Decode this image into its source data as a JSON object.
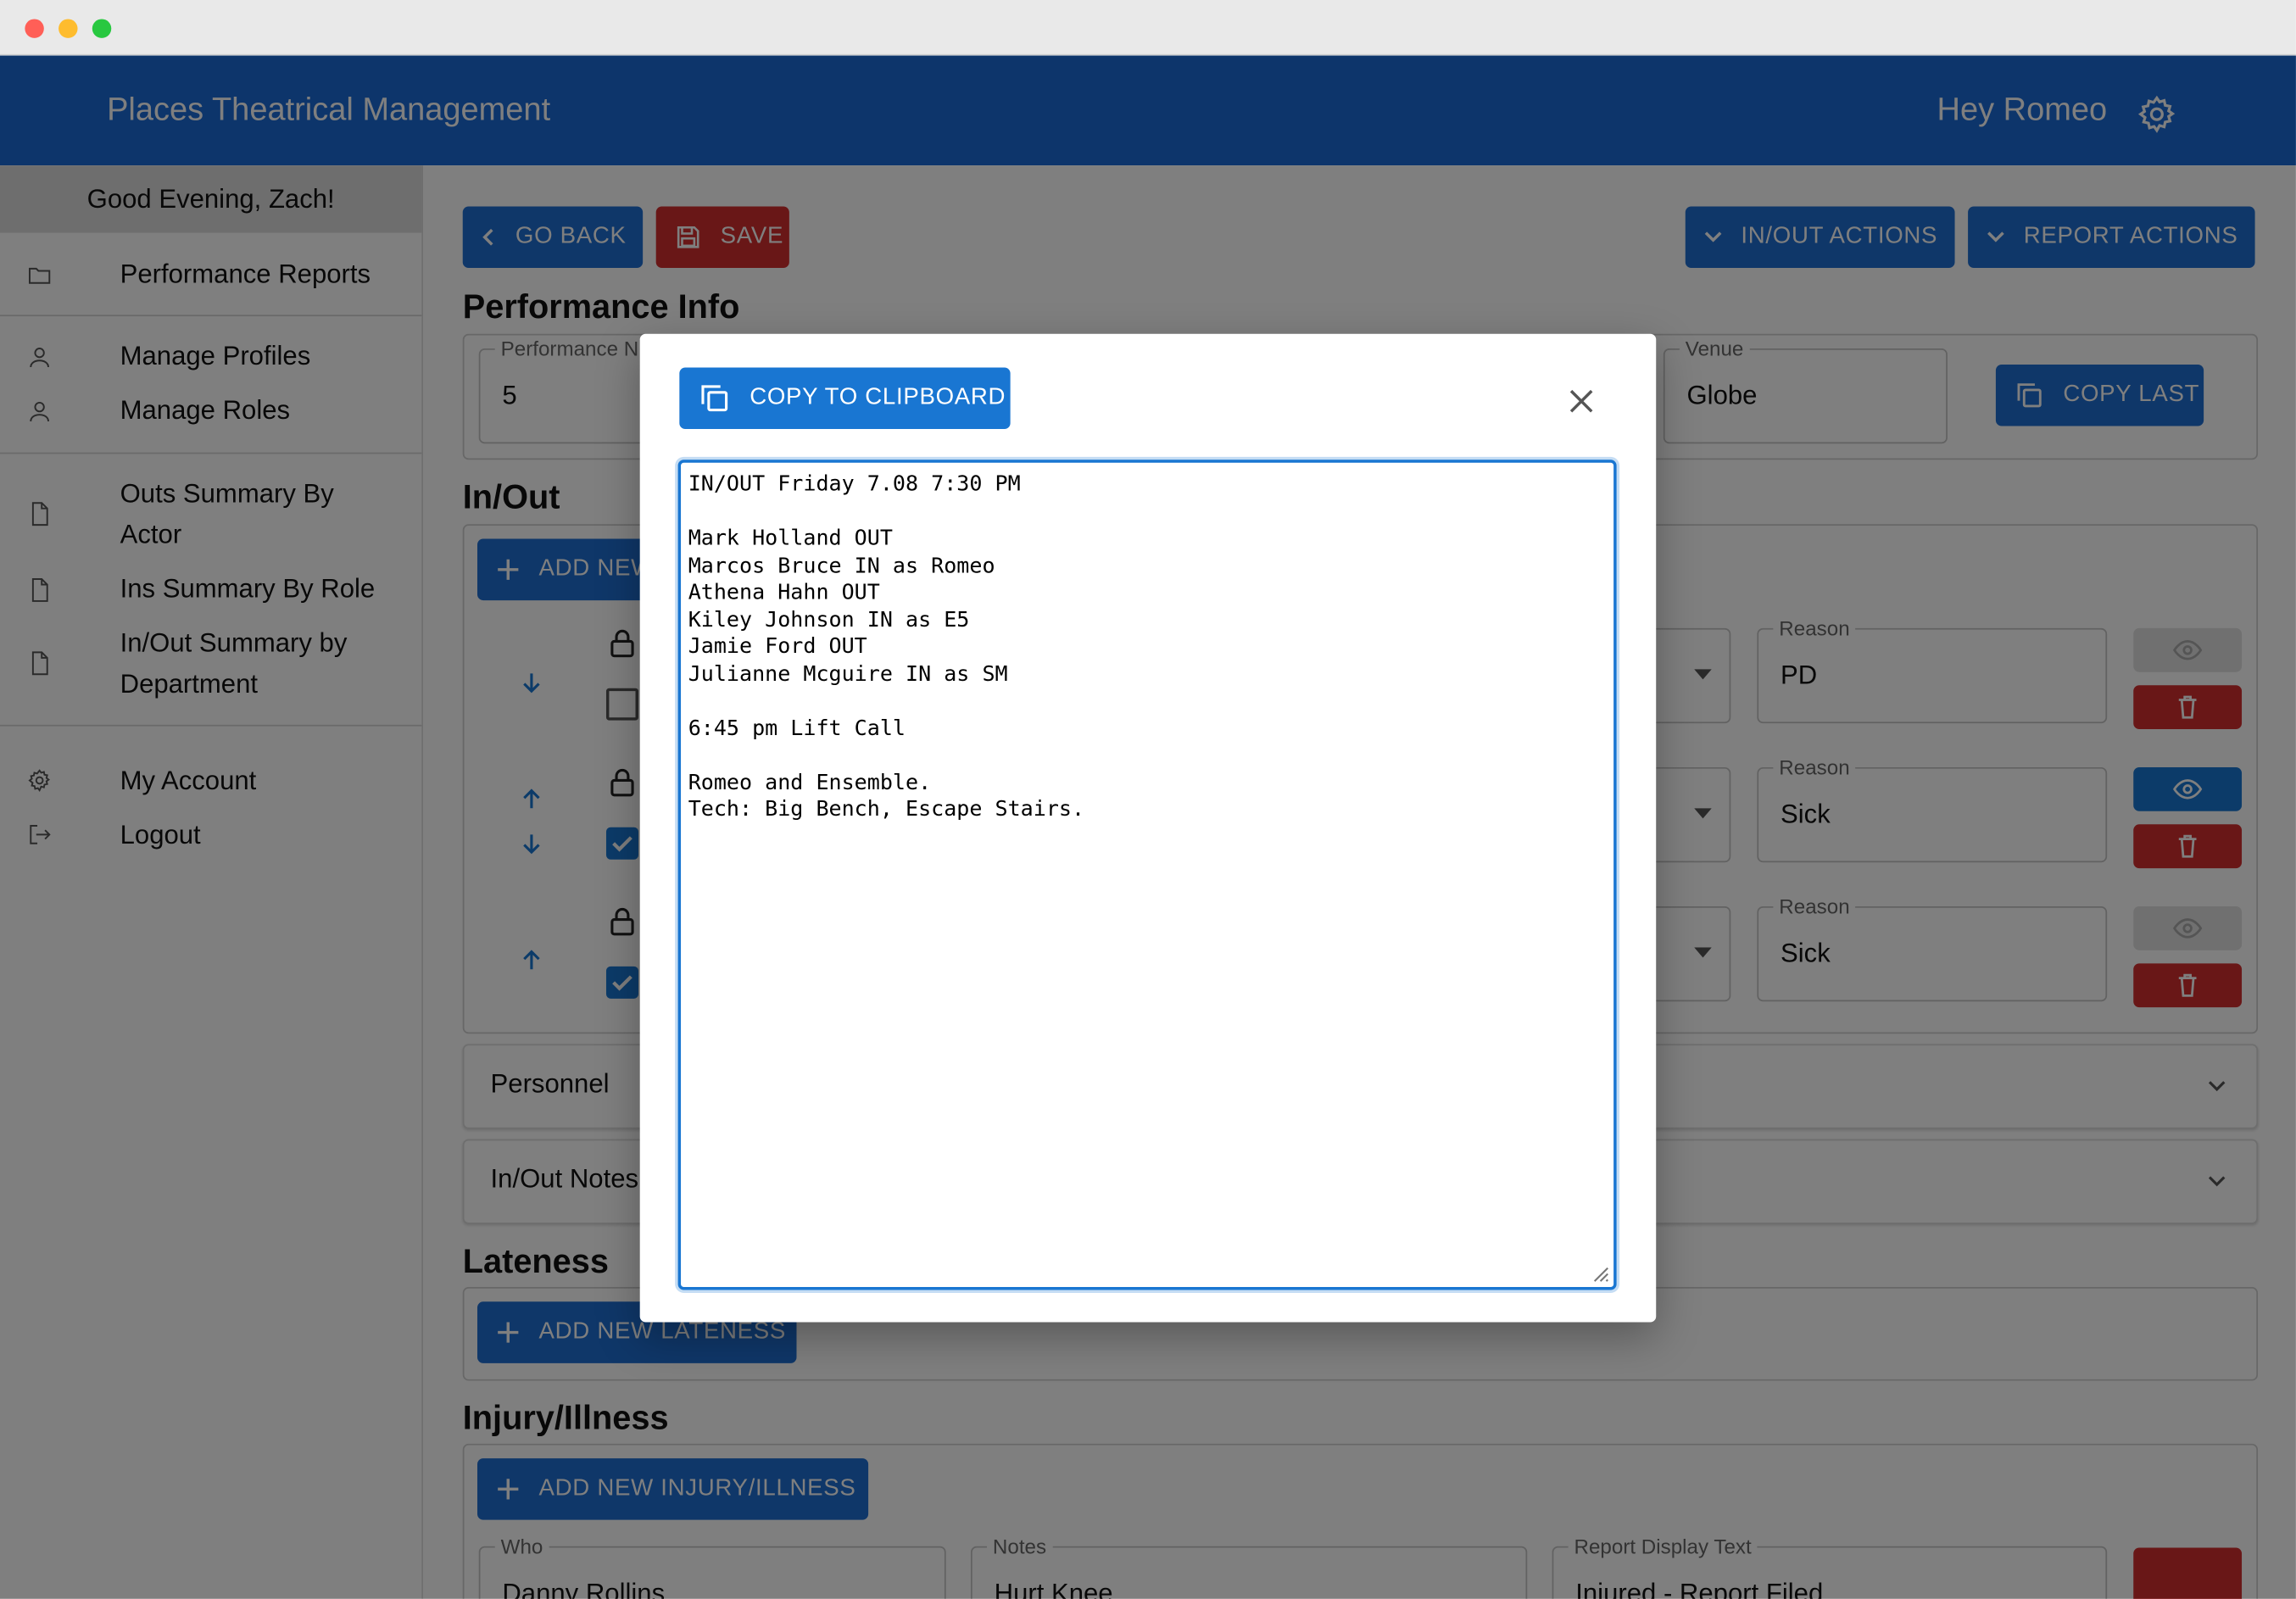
{
  "window": {
    "traffic_lights": [
      "#ff5f57",
      "#febc2e",
      "#28c840"
    ]
  },
  "topbar": {
    "title": "Places Theatrical Management",
    "greeting": "Hey Romeo",
    "accent": "#1b6bd6"
  },
  "sidebar": {
    "greeting": "Good Evening, Zach!",
    "items": [
      {
        "label": "Performance Reports",
        "icon": "folder-icon"
      },
      {
        "label": "Manage Profiles",
        "icon": "person-icon"
      },
      {
        "label": "Manage Roles",
        "icon": "person-icon"
      },
      {
        "label": "Outs Summary By Actor",
        "icon": "document-icon"
      },
      {
        "label": "Ins Summary By Role",
        "icon": "document-icon"
      },
      {
        "label": "In/Out Summary by Department",
        "icon": "document-icon"
      },
      {
        "label": "My Account",
        "icon": "gear-icon"
      },
      {
        "label": "Logout",
        "icon": "logout-icon"
      }
    ]
  },
  "toolbar": {
    "go_back": "GO BACK",
    "save": "SAVE",
    "inout_actions": "IN/OUT ACTIONS",
    "report_actions": "REPORT ACTIONS"
  },
  "performance_info": {
    "heading": "Performance Info",
    "performance_number_label": "Performance N",
    "performance_number": "5",
    "venue_label": "Venue",
    "venue": "Globe",
    "copy_last": "COPY LAST"
  },
  "inout": {
    "heading": "In/Out",
    "add_new": "ADD NEW",
    "reason_label": "Reason",
    "rows": [
      {
        "reason": "PD",
        "checked": false,
        "visible": false
      },
      {
        "reason": "Sick",
        "checked": true,
        "visible": true
      },
      {
        "reason": "Sick",
        "checked": true,
        "visible": false
      }
    ]
  },
  "accordions": {
    "personnel": "Personnel",
    "inout_notes": "In/Out Notes"
  },
  "lateness": {
    "heading": "Lateness",
    "add_new": "ADD NEW LATENESS"
  },
  "injury": {
    "heading": "Injury/Illness",
    "add_new": "ADD NEW INJURY/ILLNESS",
    "who_label": "Who",
    "who": "Danny Rollins",
    "notes_label": "Notes",
    "notes": "Hurt Knee",
    "display_label": "Report Display Text",
    "display": "Injured - Report Filed"
  },
  "modal": {
    "copy_button": "COPY TO CLIPBOARD",
    "text": "IN/OUT Friday 7.08 7:30 PM\n\nMark Holland OUT\nMarcos Bruce IN as Romeo\nAthena Hahn OUT\nKiley Johnson IN as E5\nJamie Ford OUT\nJulianne Mcguire IN as SM\n\n6:45 pm Lift Call\n\nRomeo and Ensemble.\nTech: Big Bench, Escape Stairs."
  }
}
